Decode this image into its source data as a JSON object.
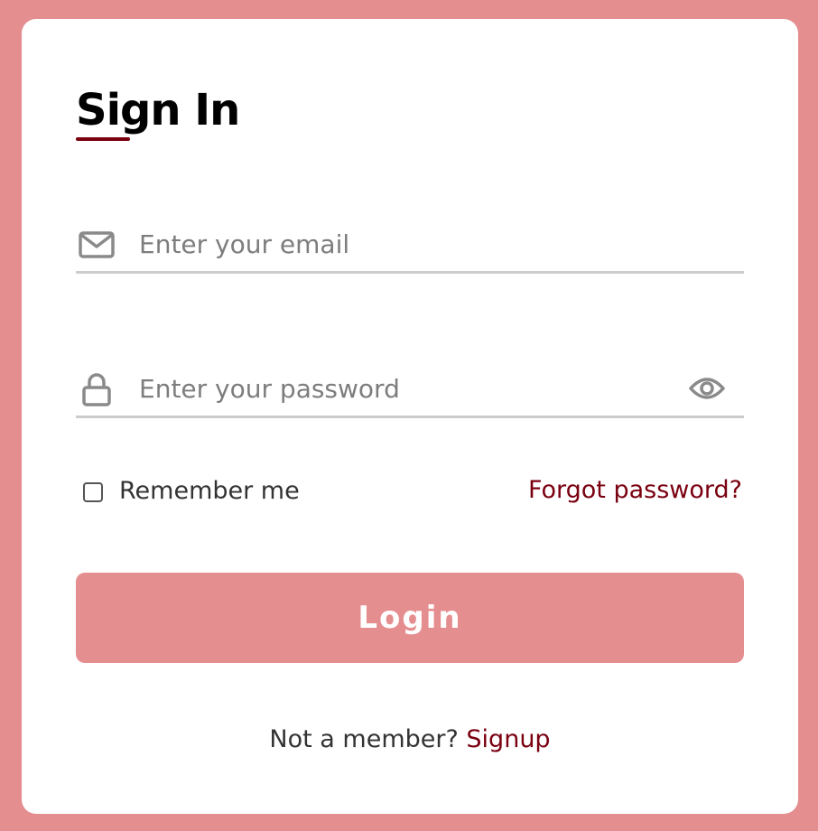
{
  "form": {
    "title": "Sign In",
    "email": {
      "placeholder": "Enter your email",
      "value": "",
      "icon": "envelope-icon"
    },
    "password": {
      "placeholder": "Enter your password",
      "value": "",
      "icon": "lock-icon",
      "toggle_icon": "eye-icon"
    },
    "remember_me": {
      "label": "Remember me",
      "checked": false
    },
    "forgot_password_label": "Forgot password?",
    "login_label": "Login",
    "signup_prompt": "Not a member?",
    "signup_label": "Signup"
  },
  "colors": {
    "background": "#e58e90",
    "card": "#ffffff",
    "accent": "#7a0010",
    "button": "#e58e90",
    "input_border": "#cccccc"
  }
}
